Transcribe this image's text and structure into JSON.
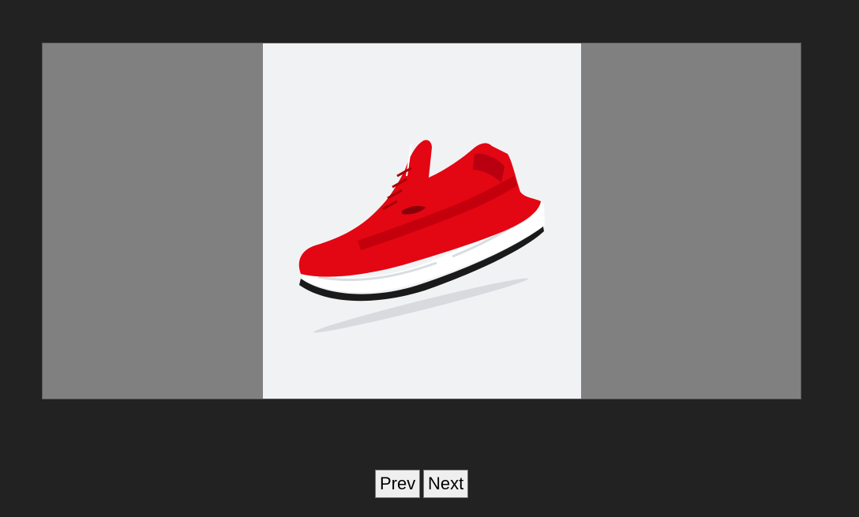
{
  "slider": {
    "current_image": "red-sneaker-image",
    "colors": {
      "page_background": "#222222",
      "side_panels": "#808080",
      "slide_background": "#f1f2f4",
      "shoe_upper": "#e30613",
      "shoe_sole": "#ffffff"
    }
  },
  "controls": {
    "prev_label": "Prev",
    "next_label": "Next"
  }
}
